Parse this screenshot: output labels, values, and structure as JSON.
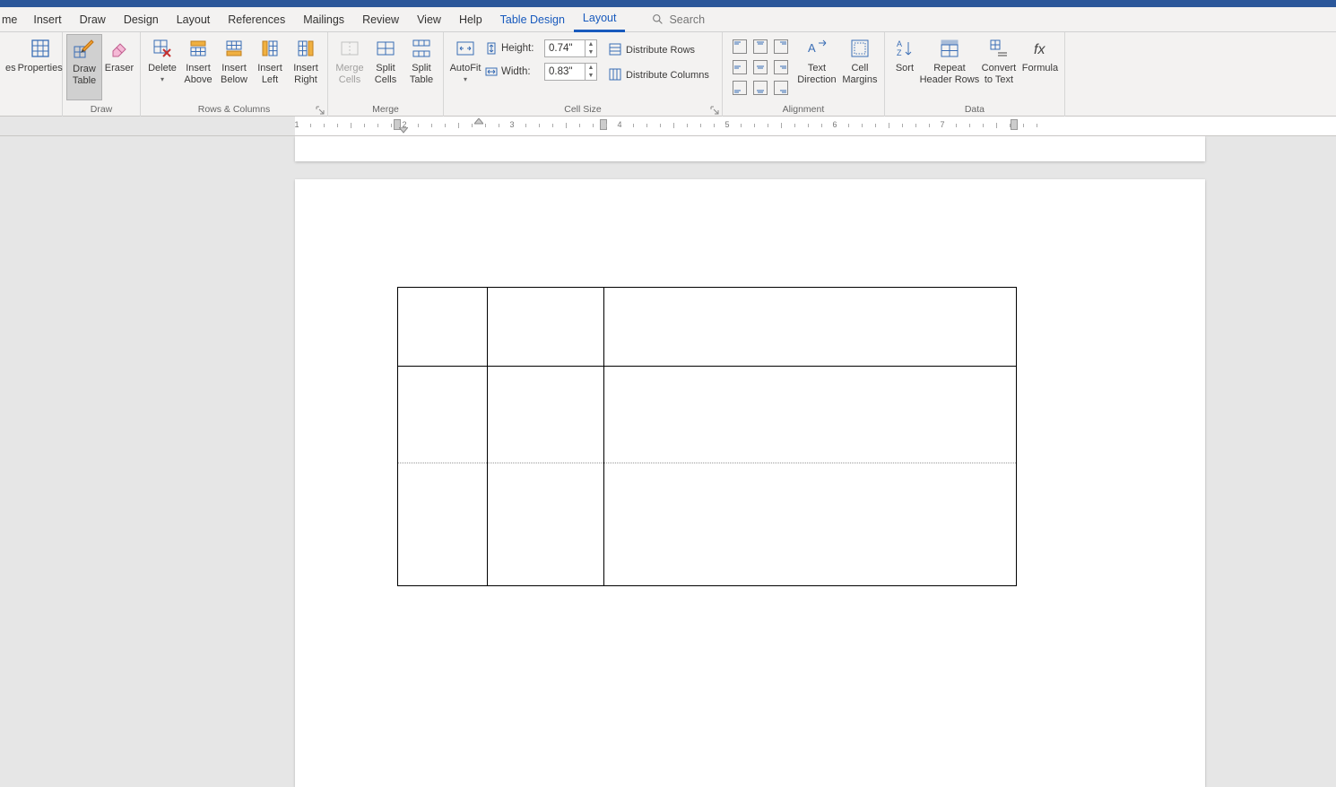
{
  "tabs": {
    "home_partial": "me",
    "insert": "Insert",
    "draw": "Draw",
    "design": "Design",
    "layout": "Layout",
    "references": "References",
    "mailings": "Mailings",
    "review": "Review",
    "view": "View",
    "help": "Help",
    "table_design": "Table Design",
    "table_layout": "Layout"
  },
  "search": {
    "placeholder": "Search"
  },
  "ribbon": {
    "table_group": {
      "properties": "Properties",
      "partial_btn": "es"
    },
    "draw_group": {
      "label": "Draw",
      "draw_table": "Draw\nTable",
      "eraser": "Eraser"
    },
    "rows_cols_group": {
      "label": "Rows & Columns",
      "delete": "Delete",
      "insert_above": "Insert\nAbove",
      "insert_below": "Insert\nBelow",
      "insert_left": "Insert\nLeft",
      "insert_right": "Insert\nRight"
    },
    "merge_group": {
      "label": "Merge",
      "merge_cells": "Merge\nCells",
      "split_cells": "Split\nCells",
      "split_table": "Split\nTable"
    },
    "cellsize_group": {
      "label": "Cell Size",
      "autofit": "AutoFit",
      "height_label": "Height:",
      "height_value": "0.74\"",
      "width_label": "Width:",
      "width_value": "0.83\"",
      "dist_rows": "Distribute Rows",
      "dist_cols": "Distribute Columns"
    },
    "alignment_group": {
      "label": "Alignment",
      "text_direction": "Text\nDirection",
      "cell_margins": "Cell\nMargins"
    },
    "data_group": {
      "label": "Data",
      "sort": "Sort",
      "repeat_header": "Repeat\nHeader Rows",
      "convert": "Convert\nto Text",
      "formula": "Formula"
    }
  },
  "ruler_numbers": [
    "1",
    "2",
    "3",
    "4",
    "5",
    "6",
    "7"
  ]
}
